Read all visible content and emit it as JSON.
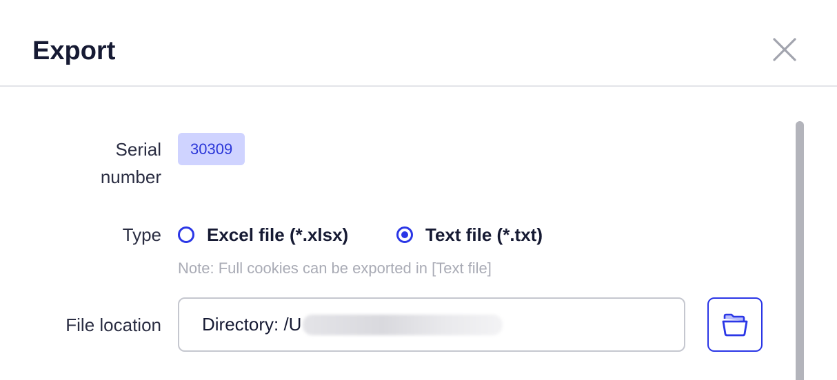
{
  "dialog": {
    "title": "Export",
    "close_icon": "close-icon"
  },
  "form": {
    "serial": {
      "label": "Serial number",
      "value": "30309"
    },
    "type": {
      "label": "Type",
      "options": [
        {
          "label": "Excel file (*.xlsx)",
          "selected": false
        },
        {
          "label": "Text file (*.txt)",
          "selected": true
        }
      ],
      "note": "Note: Full cookies can be exported in [Text file]"
    },
    "file_location": {
      "label": "File location",
      "value": "Directory: /U",
      "folder_icon": "folder-open-icon"
    }
  },
  "colors": {
    "accent": "#2a36e6",
    "badge_bg": "#cfd3ff",
    "title": "#161a33",
    "note": "#a9abb5"
  }
}
